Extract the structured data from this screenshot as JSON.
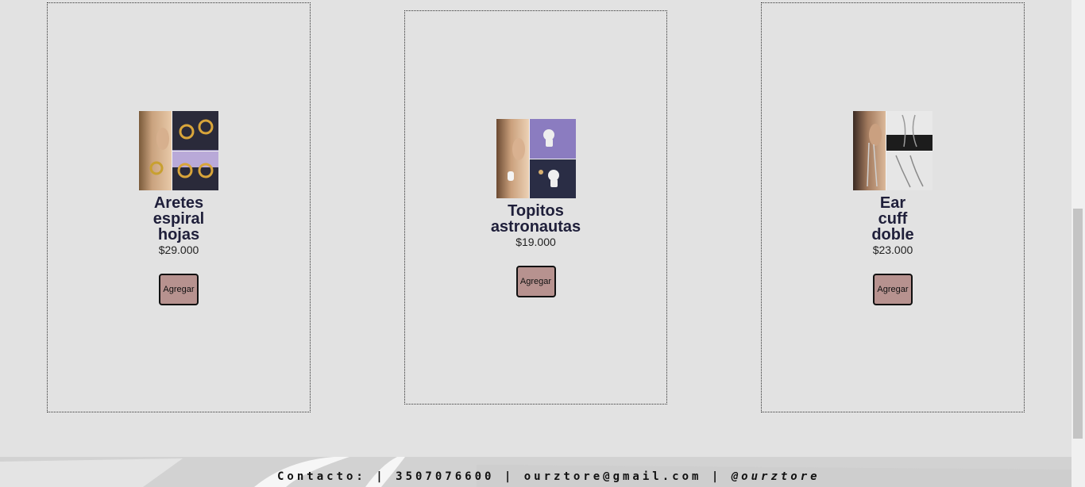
{
  "products": [
    {
      "title": "Aretes espiral hojas",
      "price": "$29.000",
      "button": "Agregar"
    },
    {
      "title": "Topitos astronautas",
      "price": "$19.000",
      "button": "Agregar"
    },
    {
      "title": "Ear cuff doble",
      "price": "$23.000",
      "button": "Agregar"
    }
  ],
  "footer": {
    "contact": "Contacto: | 3507076600 | ourztore@gmail.com |",
    "handle": "@ourztore"
  },
  "colors": {
    "background": "#e2e2e2",
    "button": "#b7928f",
    "title": "#1f1f3a"
  }
}
